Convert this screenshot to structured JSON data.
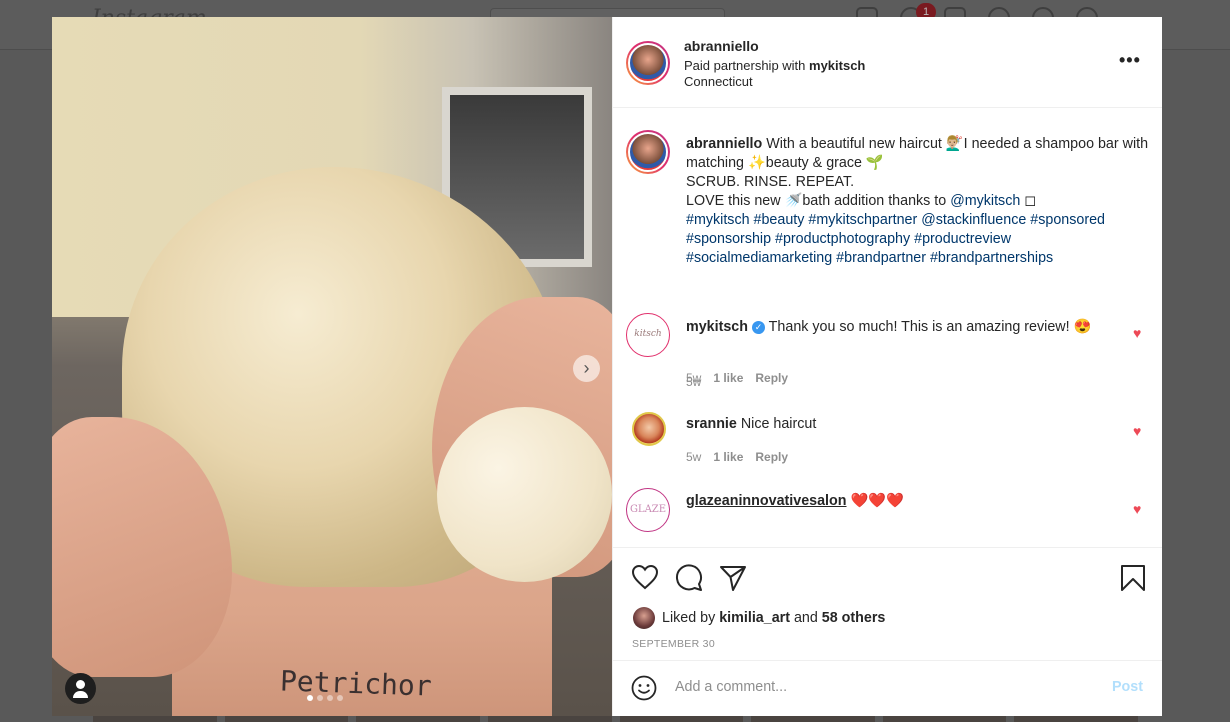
{
  "background": {
    "logo_text": "Instagram",
    "notification_count": "1"
  },
  "photo": {
    "tattoo_text": "Petrichor",
    "next_icon": "chevron-right-icon",
    "user_tag_icon": "user-icon",
    "carousel_dots": 4,
    "carousel_active": 0
  },
  "post_header": {
    "username": "abranniello",
    "partnership_prefix": "Paid partnership with ",
    "partner": "mykitsch",
    "location": "Connecticut",
    "more_icon": "more-options-icon"
  },
  "caption": {
    "username": "abranniello",
    "line1": " With a beautiful new haircut 💇🏼‍♂️I needed a shampoo bar with matching ✨beauty & grace 🌱",
    "line2": "SCRUB. RINSE. REPEAT.",
    "line3_prefix": "LOVE this new 🚿bath addition thanks to ",
    "line3_mention": "@mykitsch",
    "line3_suffix": " ◻",
    "hashtags": "#mykitsch #beauty #mykitschpartner @stackinfluence #sponsored #sponsorship #productphotography #productreview #socialmediamarketing #brandpartner #brandpartnerships",
    "time": "5w"
  },
  "comments": [
    {
      "username": "mykitsch",
      "verified": true,
      "text": " Thank you so much! This is an amazing review! 😍",
      "time": "5w",
      "likes": "1 like",
      "reply": "Reply",
      "avatar_text": "kitsch"
    },
    {
      "username": "srannie",
      "verified": false,
      "text": " Nice haircut",
      "time": "5w",
      "likes": "1 like",
      "reply": "Reply"
    },
    {
      "username": "glazeaninnovativesalon",
      "verified": false,
      "text": " ❤️❤️❤️",
      "avatar_text": "GLAZE"
    }
  ],
  "likes": {
    "prefix": "Liked by ",
    "user": "kimilia_art",
    "middle": " and ",
    "others": "58 others",
    "date": "SEPTEMBER 30"
  },
  "add_comment": {
    "placeholder": "Add a comment...",
    "post_label": "Post"
  },
  "colors": {
    "heart": "#ed4956",
    "link": "#00376b",
    "post_disabled": "#b2dffc",
    "verified": "#3897f0"
  }
}
